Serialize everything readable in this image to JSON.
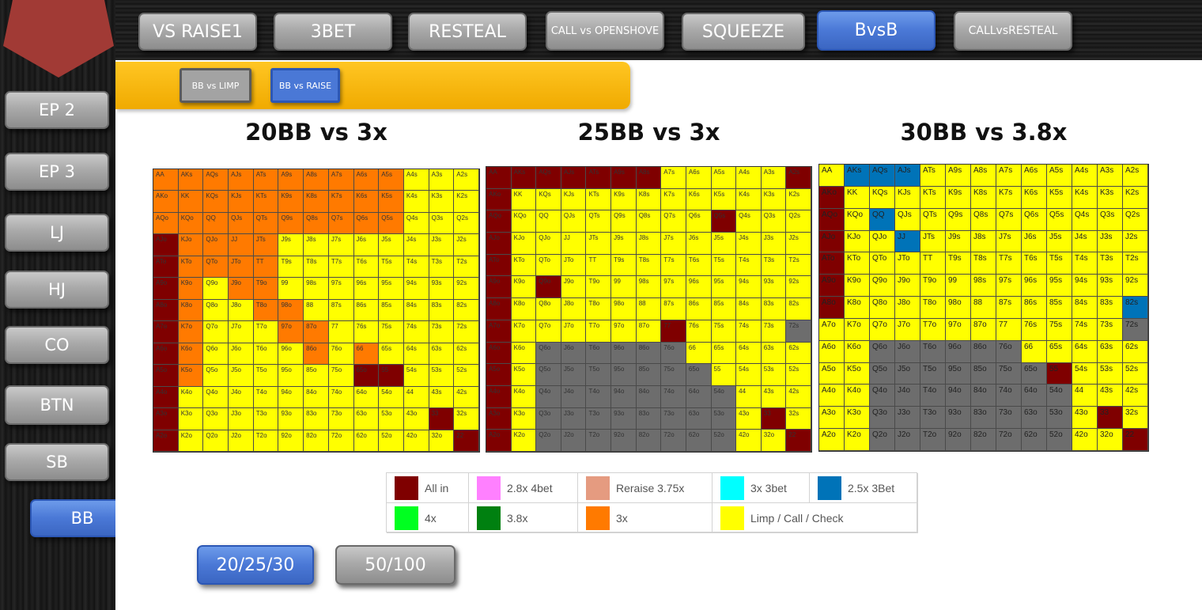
{
  "top_tabs": [
    {
      "label": "VS RAISE1",
      "active": false
    },
    {
      "label": "3BET",
      "active": false
    },
    {
      "label": "RESTEAL",
      "active": false
    },
    {
      "label": "CALL vs OPENSHOVE",
      "active": false
    },
    {
      "label": "SQUEEZE",
      "active": false
    },
    {
      "label": "BvsB",
      "active": true
    },
    {
      "label": "CALLvsRESTEAL",
      "active": false
    }
  ],
  "positions": [
    {
      "label": "EP 2",
      "active": false
    },
    {
      "label": "EP 3",
      "active": false
    },
    {
      "label": "LJ",
      "active": false
    },
    {
      "label": "HJ",
      "active": false
    },
    {
      "label": "CO",
      "active": false
    },
    {
      "label": "BTN",
      "active": false
    },
    {
      "label": "SB",
      "active": false
    },
    {
      "label": "BB",
      "active": true
    }
  ],
  "sub_tabs": [
    {
      "label": "BB vs LIMP",
      "active": false
    },
    {
      "label": "BB vs RAISE",
      "active": true
    }
  ],
  "charts": [
    {
      "title": "20BB vs 3x"
    },
    {
      "title": "25BB vs 3x"
    },
    {
      "title": "30BB vs 3.8x"
    }
  ],
  "hand_grid_ranks": [
    "A",
    "K",
    "Q",
    "J",
    "T",
    "9",
    "8",
    "7",
    "6",
    "5",
    "4",
    "3",
    "2"
  ],
  "legend": [
    {
      "label": "All in",
      "color": "#7f0000"
    },
    {
      "label": "2.8x 4bet",
      "color": "#ff80ff"
    },
    {
      "label": "Reraise 3.75x",
      "color": "#e59b80"
    },
    {
      "label": "3x 3bet",
      "color": "#00ffff"
    },
    {
      "label": "2.5x 3Bet",
      "color": "#0073b8"
    },
    {
      "label": "4x",
      "color": "#00ff20"
    },
    {
      "label": "3.8x",
      "color": "#008010"
    },
    {
      "label": "3x",
      "color": "#ff7a00"
    },
    {
      "label": "Limp / Call / Check",
      "color": "#ffff00"
    }
  ],
  "stack_buttons": [
    {
      "label": "20/25/30",
      "active": true
    },
    {
      "label": "50/100",
      "active": false
    }
  ],
  "colors": {
    "accent_blue": "#4a78d6",
    "tab_gray": "#a9a9a9",
    "subbar_gold": "#f9b814",
    "logo_red": "#a13a35",
    "fold_gray": "#6d6d6d"
  }
}
